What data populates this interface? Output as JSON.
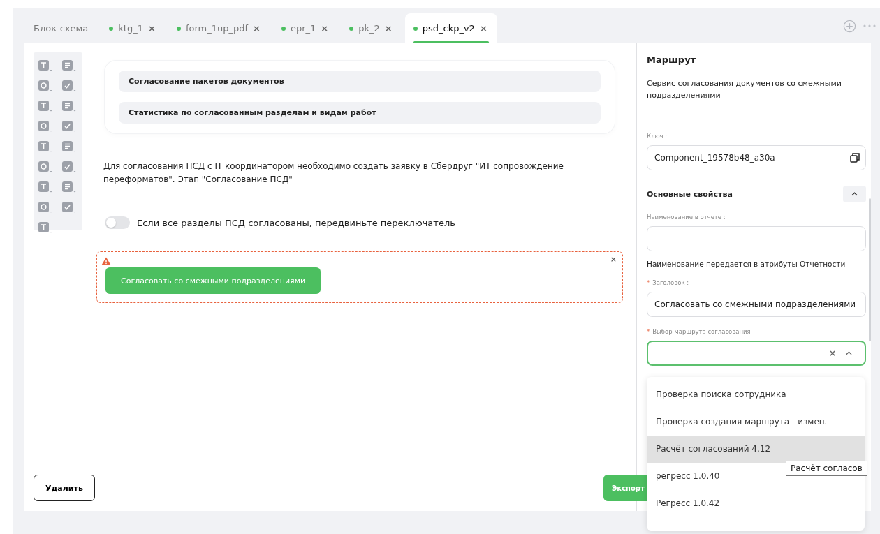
{
  "tabs": [
    {
      "label": "Блок-схема",
      "dot": false,
      "closable": false,
      "selected": false
    },
    {
      "label": "ktg_1",
      "dot": true,
      "closable": true,
      "selected": false
    },
    {
      "label": "form_1up_pdf",
      "dot": true,
      "closable": true,
      "selected": false
    },
    {
      "label": "epr_1",
      "dot": true,
      "closable": true,
      "selected": false
    },
    {
      "label": "pk_2",
      "dot": true,
      "closable": true,
      "selected": false
    },
    {
      "label": "psd_ckp_v2",
      "dot": true,
      "closable": true,
      "selected": true
    }
  ],
  "tab_close_glyph": "×",
  "menu_items": [
    "Согласование пакетов документов",
    "Статистика по согласованным разделам и видам работ"
  ],
  "notice": "Для согласования ПСД с IT координатором необходимо создать заявку в Сбердруг \"ИТ сопровождение переформатов\". Этап \"Согласование ПСД\"",
  "toggle": {
    "label": "Если все разделы ПСД согласованы, передвиньте переключатель",
    "on": false
  },
  "selected_block": {
    "close_glyph": "×",
    "warning": true,
    "button": "Согласовать со смежными подразделениями"
  },
  "delete_button": "Удалить",
  "export_button": "Экспорт",
  "panel": {
    "title": "Маршрут",
    "description": "Сервис согласования документов со смежными подразделениями",
    "key_label": "Ключ :",
    "key_value": "Component_19578b48_a30a",
    "section": {
      "title": "Основные свойства",
      "expanded": true
    },
    "required_mark": "*",
    "fields": [
      {
        "label": "Наименование в отчете :",
        "required": false,
        "hint": "Наименование передается в атрибуты Отчетности"
      },
      {
        "label": "Заголовок :",
        "required": true,
        "value": "Согласовать со смежными подразделениями"
      }
    ],
    "route_select": {
      "label": "Выбор маршрута согласования",
      "required": true,
      "focused": true,
      "clear_glyph": "×"
    }
  },
  "dropdown": [
    {
      "label": "Проверка поиска сотрудника",
      "selected": false
    },
    {
      "label": "Проверка создания маршрута - измен.",
      "selected": false
    },
    {
      "label": "Расчёт согласований 4.12",
      "selected": true
    },
    {
      "label": "регресс 1.0.40",
      "selected": false
    },
    {
      "label": "Регресс 1.0.42",
      "selected": false
    }
  ],
  "tooltip": "Расчёт согласов"
}
